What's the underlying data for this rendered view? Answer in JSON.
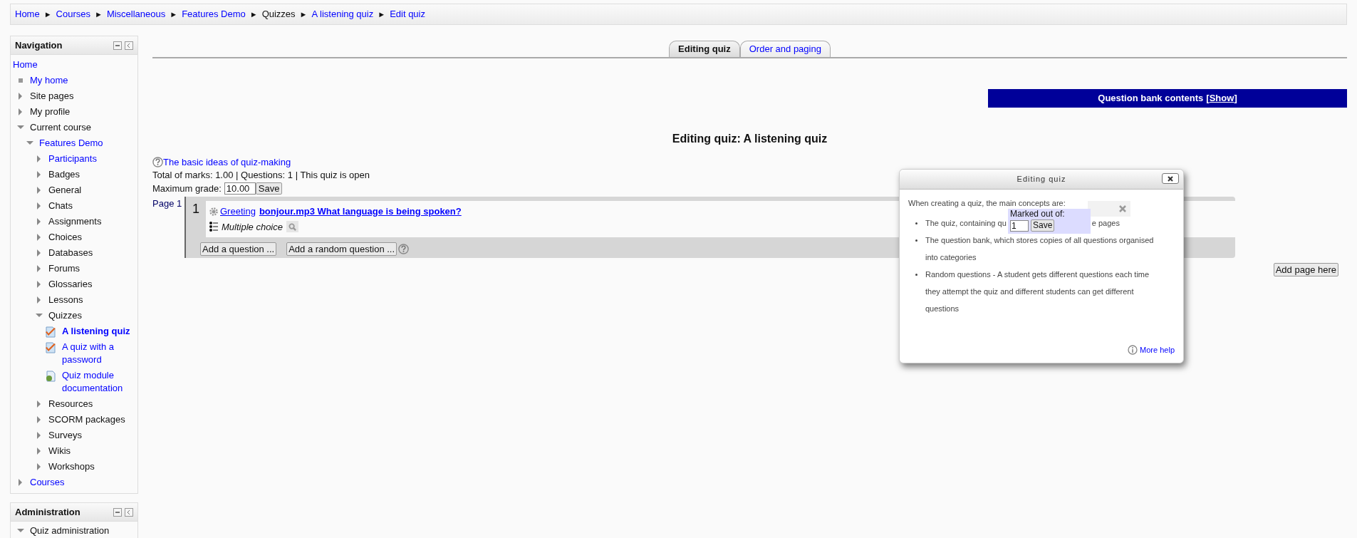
{
  "breadcrumb": [
    {
      "label": "Home",
      "link": true
    },
    {
      "label": "Courses",
      "link": true
    },
    {
      "label": "Miscellaneous",
      "link": true
    },
    {
      "label": "Features Demo",
      "link": true
    },
    {
      "label": "Quizzes",
      "link": false
    },
    {
      "label": "A listening quiz",
      "link": true
    },
    {
      "label": "Edit quiz",
      "link": true
    }
  ],
  "breadcrumb_separator": "►",
  "navigation": {
    "title": "Navigation",
    "items": [
      {
        "label": "Home",
        "kind": "plain",
        "link": true
      },
      {
        "label": "My home",
        "kind": "bullet",
        "link": true
      },
      {
        "label": "Site pages",
        "kind": "branch",
        "link": false,
        "expanded": false
      },
      {
        "label": "My profile",
        "kind": "branch",
        "link": false,
        "expanded": false
      },
      {
        "label": "Current course",
        "kind": "branch",
        "link": false,
        "expanded": true,
        "children": [
          {
            "label": "Features Demo",
            "kind": "branch",
            "link": true,
            "expanded": true,
            "children": [
              {
                "label": "Participants",
                "kind": "branch",
                "link": true,
                "expanded": false
              },
              {
                "label": "Badges",
                "kind": "branch",
                "link": false,
                "expanded": false
              },
              {
                "label": "General",
                "kind": "branch",
                "link": false,
                "expanded": false
              },
              {
                "label": "Chats",
                "kind": "branch",
                "link": false,
                "expanded": false
              },
              {
                "label": "Assignments",
                "kind": "branch",
                "link": false,
                "expanded": false
              },
              {
                "label": "Choices",
                "kind": "branch",
                "link": false,
                "expanded": false
              },
              {
                "label": "Databases",
                "kind": "branch",
                "link": false,
                "expanded": false
              },
              {
                "label": "Forums",
                "kind": "branch",
                "link": false,
                "expanded": false
              },
              {
                "label": "Glossaries",
                "kind": "branch",
                "link": false,
                "expanded": false
              },
              {
                "label": "Lessons",
                "kind": "branch",
                "link": false,
                "expanded": false
              },
              {
                "label": "Quizzes",
                "kind": "branch",
                "link": false,
                "expanded": true,
                "children": [
                  {
                    "label": "A listening quiz",
                    "kind": "quiz",
                    "link": true,
                    "selected": true
                  },
                  {
                    "label": "A quiz with a password",
                    "kind": "quiz",
                    "link": true,
                    "selected": false
                  },
                  {
                    "label": "Quiz module documentation",
                    "kind": "page",
                    "link": true,
                    "selected": false
                  }
                ]
              },
              {
                "label": "Resources",
                "kind": "branch",
                "link": false,
                "expanded": false
              },
              {
                "label": "SCORM packages",
                "kind": "branch",
                "link": false,
                "expanded": false
              },
              {
                "label": "Surveys",
                "kind": "branch",
                "link": false,
                "expanded": false
              },
              {
                "label": "Wikis",
                "kind": "branch",
                "link": false,
                "expanded": false
              },
              {
                "label": "Workshops",
                "kind": "branch",
                "link": false,
                "expanded": false
              }
            ]
          }
        ]
      },
      {
        "label": "Courses",
        "kind": "branch",
        "link": true,
        "expanded": false
      }
    ]
  },
  "administration": {
    "title": "Administration",
    "items": [
      {
        "label": "Quiz administration",
        "kind": "branch",
        "link": false,
        "expanded": true
      }
    ]
  },
  "tabs": [
    {
      "label": "Editing quiz",
      "selected": true
    },
    {
      "label": "Order and paging",
      "selected": false
    }
  ],
  "question_bank": {
    "label": "Question bank contents",
    "brackets": [
      "[",
      "]"
    ],
    "link": "Show"
  },
  "heading": "Editing quiz: A listening quiz",
  "help_link": "The basic ideas of quiz-making",
  "summary": "Total of marks: 1.00 | Questions: 1 | This quiz is open",
  "maximum_grade": {
    "label": "Maximum grade:",
    "value": "10.00",
    "button": "Save"
  },
  "page": {
    "label": "Page 1",
    "questions": [
      {
        "number": "1",
        "category": "Greeting",
        "title": "bonjour.mp3 What language is being spoken?",
        "type": "Multiple choice"
      }
    ],
    "buttons": [
      "Add a question ...",
      "Add a random question ..."
    ]
  },
  "add_page_button": "Add page here",
  "dialog": {
    "title": "Editing quiz",
    "intro": "When creating a quiz, the main concepts are:",
    "bullets": [
      [
        "The quiz, containing qu",
        "e pages"
      ],
      [
        "The question bank, which stores copies of all questions organised into categories"
      ],
      [
        "Random questions - A student gets different questions each time they attempt the quiz and different students can get different questions"
      ]
    ],
    "more_help": "More help"
  },
  "marks_popup": {
    "label": "Marked out of:",
    "value": "1",
    "button": "Save"
  }
}
